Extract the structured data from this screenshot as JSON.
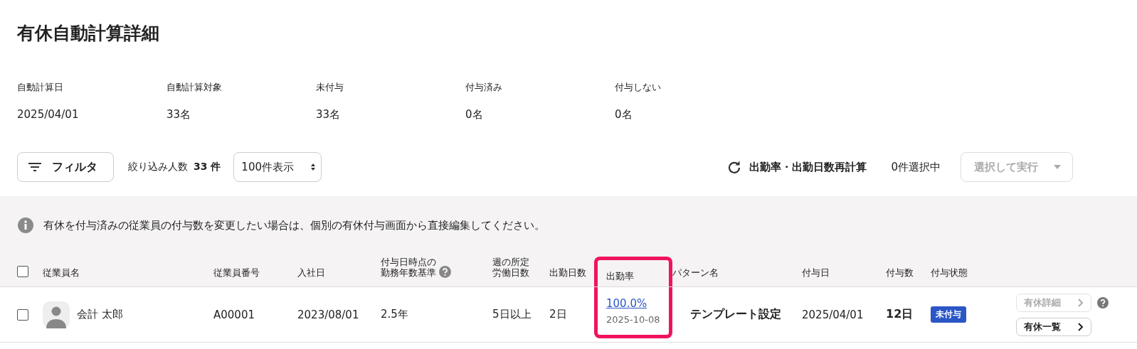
{
  "title": "有休自動計算詳細",
  "stats": [
    {
      "label": "自動計算日",
      "value": "2025/04/01"
    },
    {
      "label": "自動計算対象",
      "value": "33名"
    },
    {
      "label": "未付与",
      "value": "33名"
    },
    {
      "label": "付与済み",
      "value": "0名"
    },
    {
      "label": "付与しない",
      "value": "0名"
    }
  ],
  "toolbar": {
    "filter_button": "フィルタ",
    "filtered_label": "絞り込み人数",
    "filtered_count": "33 件",
    "page_size": "100件表示",
    "recalc_button": "出勤率・出勤日数再計算",
    "selected_count": "0件選択中",
    "run_button": {
      "label": "選択して実行",
      "disabled": true
    }
  },
  "notice": "有休を付与済みの従業員の付与数を変更したい場合は、個別の有休付与画面から直接編集してください。",
  "table": {
    "select_all_checked": false,
    "columns": [
      {
        "label": "従業員名",
        "highlighted": false
      },
      {
        "label": "従業員番号",
        "highlighted": false
      },
      {
        "label": "入社日",
        "highlighted": false
      },
      {
        "label": "付与日時点の勤務年数基準",
        "highlighted": false,
        "help": true
      },
      {
        "label": "週の所定労働日数",
        "highlighted": false
      },
      {
        "label": "出勤日数",
        "highlighted": false
      },
      {
        "label": "出勤率",
        "highlighted": true
      },
      {
        "label": "パターン名",
        "highlighted": false
      },
      {
        "label": "付与日",
        "highlighted": false
      },
      {
        "label": "付与数",
        "highlighted": false
      },
      {
        "label": "付与状態",
        "highlighted": false
      }
    ],
    "rows": [
      {
        "checked": false,
        "name": "会計 太郎",
        "number": "A00001",
        "joined": "2023/08/01",
        "years": "2.5年",
        "weekly_days": "5日以上",
        "attendance_days": "2日",
        "rate": "100.0%",
        "rate_date": "2025-10-08",
        "pattern": "テンプレート設定",
        "grant_date": "2025/04/01",
        "grant_count": "12日",
        "status": "未付与",
        "detail_button": {
          "label": "有休詳細",
          "disabled": true
        },
        "list_button": {
          "label": "有休一覧",
          "disabled": false
        }
      }
    ]
  }
}
